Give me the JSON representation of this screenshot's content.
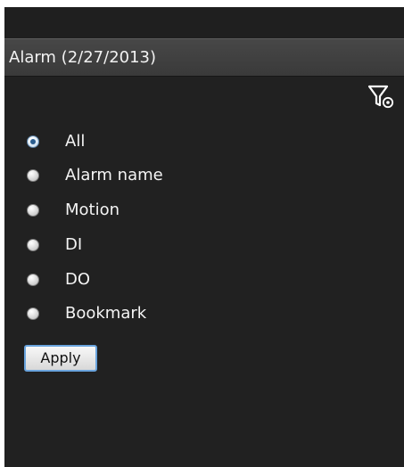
{
  "panel": {
    "title": "Alarm (2/27/2013)"
  },
  "toolbar": {
    "filter_icon": "filter-settings-icon"
  },
  "filters": {
    "selected": "All",
    "options": [
      {
        "label": "All",
        "selected": true
      },
      {
        "label": "Alarm name",
        "selected": false
      },
      {
        "label": "Motion",
        "selected": false
      },
      {
        "label": "DI",
        "selected": false
      },
      {
        "label": "DO",
        "selected": false
      },
      {
        "label": "Bookmark",
        "selected": false
      }
    ]
  },
  "actions": {
    "apply_label": "Apply"
  },
  "colors": {
    "panel_background": "#212121",
    "header_background": "#414141",
    "text": "#f4f4f4",
    "button_border": "#6aa4dd"
  }
}
